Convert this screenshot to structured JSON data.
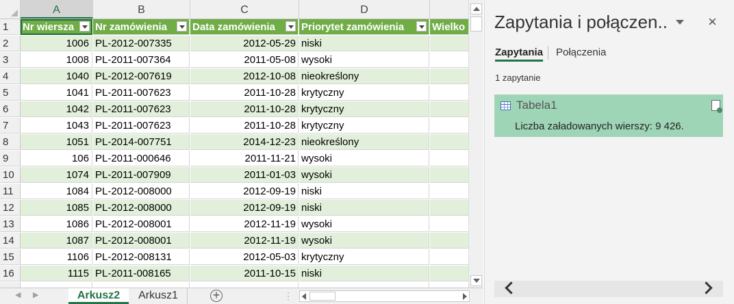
{
  "columns": [
    "A",
    "B",
    "C",
    "D"
  ],
  "header_row": {
    "num": "1",
    "cells": [
      "Nr wiersza",
      "Nr zamówienia",
      "Data zamówienia",
      "Priorytet zamówienia",
      "Wielko"
    ]
  },
  "rows": [
    {
      "num": "2",
      "a": "1006",
      "b": "PL-2012-007335",
      "c": "2012-05-29",
      "d": "niski"
    },
    {
      "num": "3",
      "a": "1008",
      "b": "PL-2011-007364",
      "c": "2011-05-08",
      "d": "wysoki"
    },
    {
      "num": "4",
      "a": "1040",
      "b": "PL-2012-007619",
      "c": "2012-10-08",
      "d": "nieokreślony"
    },
    {
      "num": "5",
      "a": "1041",
      "b": "PL-2011-007623",
      "c": "2011-10-28",
      "d": "krytyczny"
    },
    {
      "num": "6",
      "a": "1042",
      "b": "PL-2011-007623",
      "c": "2011-10-28",
      "d": "krytyczny"
    },
    {
      "num": "7",
      "a": "1043",
      "b": "PL-2011-007623",
      "c": "2011-10-28",
      "d": "krytyczny"
    },
    {
      "num": "8",
      "a": "1051",
      "b": "PL-2014-007751",
      "c": "2014-12-23",
      "d": "nieokreślony"
    },
    {
      "num": "9",
      "a": "106",
      "b": "PL-2011-000646",
      "c": "2011-11-21",
      "d": "wysoki"
    },
    {
      "num": "10",
      "a": "1074",
      "b": "PL-2011-007909",
      "c": "2011-01-03",
      "d": "wysoki"
    },
    {
      "num": "11",
      "a": "1084",
      "b": "PL-2012-008000",
      "c": "2012-09-19",
      "d": "niski"
    },
    {
      "num": "12",
      "a": "1085",
      "b": "PL-2012-008000",
      "c": "2012-09-19",
      "d": "niski"
    },
    {
      "num": "13",
      "a": "1086",
      "b": "PL-2012-008001",
      "c": "2012-11-19",
      "d": "wysoki"
    },
    {
      "num": "14",
      "a": "1087",
      "b": "PL-2012-008001",
      "c": "2012-11-19",
      "d": "wysoki"
    },
    {
      "num": "15",
      "a": "1106",
      "b": "PL-2012-008131",
      "c": "2012-05-03",
      "d": "krytyczny"
    },
    {
      "num": "16",
      "a": "1115",
      "b": "PL-2011-008165",
      "c": "2011-10-15",
      "d": "niski"
    }
  ],
  "sheet_tabs": {
    "active": "Arkusz2",
    "inactive": "Arkusz1"
  },
  "pane": {
    "title": "Zapytania i połączen..",
    "close_icon": "×",
    "tab_queries": "Zapytania",
    "tab_connections": "Połączenia",
    "query_count": "1 zapytanie",
    "query": {
      "name": "Tabela1",
      "info": "Liczba załadowanych wierszy: 9 426."
    }
  },
  "colors": {
    "accent": "#217346",
    "table_header": "#70ad47",
    "band": "#e2efda",
    "query_bg": "#9fd5b7"
  }
}
